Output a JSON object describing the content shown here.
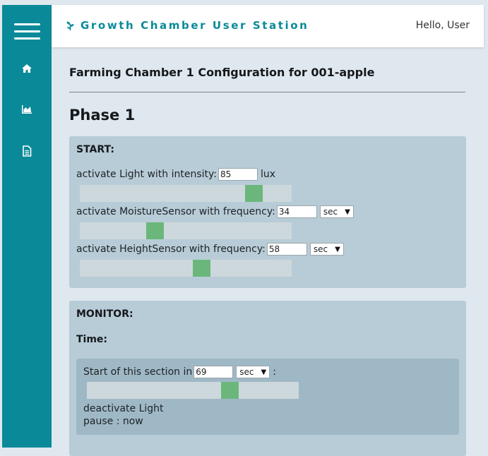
{
  "app": {
    "title": "Growth Chamber User Station",
    "greeting": "Hello, User"
  },
  "sidebar": {
    "menu_icon": "hamburger-menu-icon",
    "items": [
      {
        "icon": "home-icon"
      },
      {
        "icon": "chart-icon"
      },
      {
        "icon": "document-icon"
      }
    ]
  },
  "page": {
    "title": "Farming Chamber 1 Configuration for 001-apple",
    "phase_title": "Phase 1"
  },
  "start": {
    "label": "START:",
    "rows": [
      {
        "text": "activate Light with intensity:",
        "value": "85",
        "unit": "lux",
        "slider_fraction": 0.85
      },
      {
        "text": "activate MoistureSensor with frequency:",
        "value": "34",
        "unit": "sec",
        "slider_fraction": 0.34
      },
      {
        "text": "activate HeightSensor with frequency:",
        "value": "58",
        "unit": "sec",
        "slider_fraction": 0.58
      }
    ]
  },
  "monitor": {
    "label": "MONITOR:",
    "time_label": "Time:",
    "section": {
      "text": "Start of this section in",
      "value": "69",
      "unit": "sec",
      "suffix": ":",
      "slider_fraction": 0.69,
      "action": "deactivate Light",
      "pause": "pause : now"
    }
  },
  "colors": {
    "accent": "#0a8a99",
    "panel": "#b8ccd7",
    "subpanel": "#9fb8c6",
    "slider_thumb": "#6bb77b"
  }
}
